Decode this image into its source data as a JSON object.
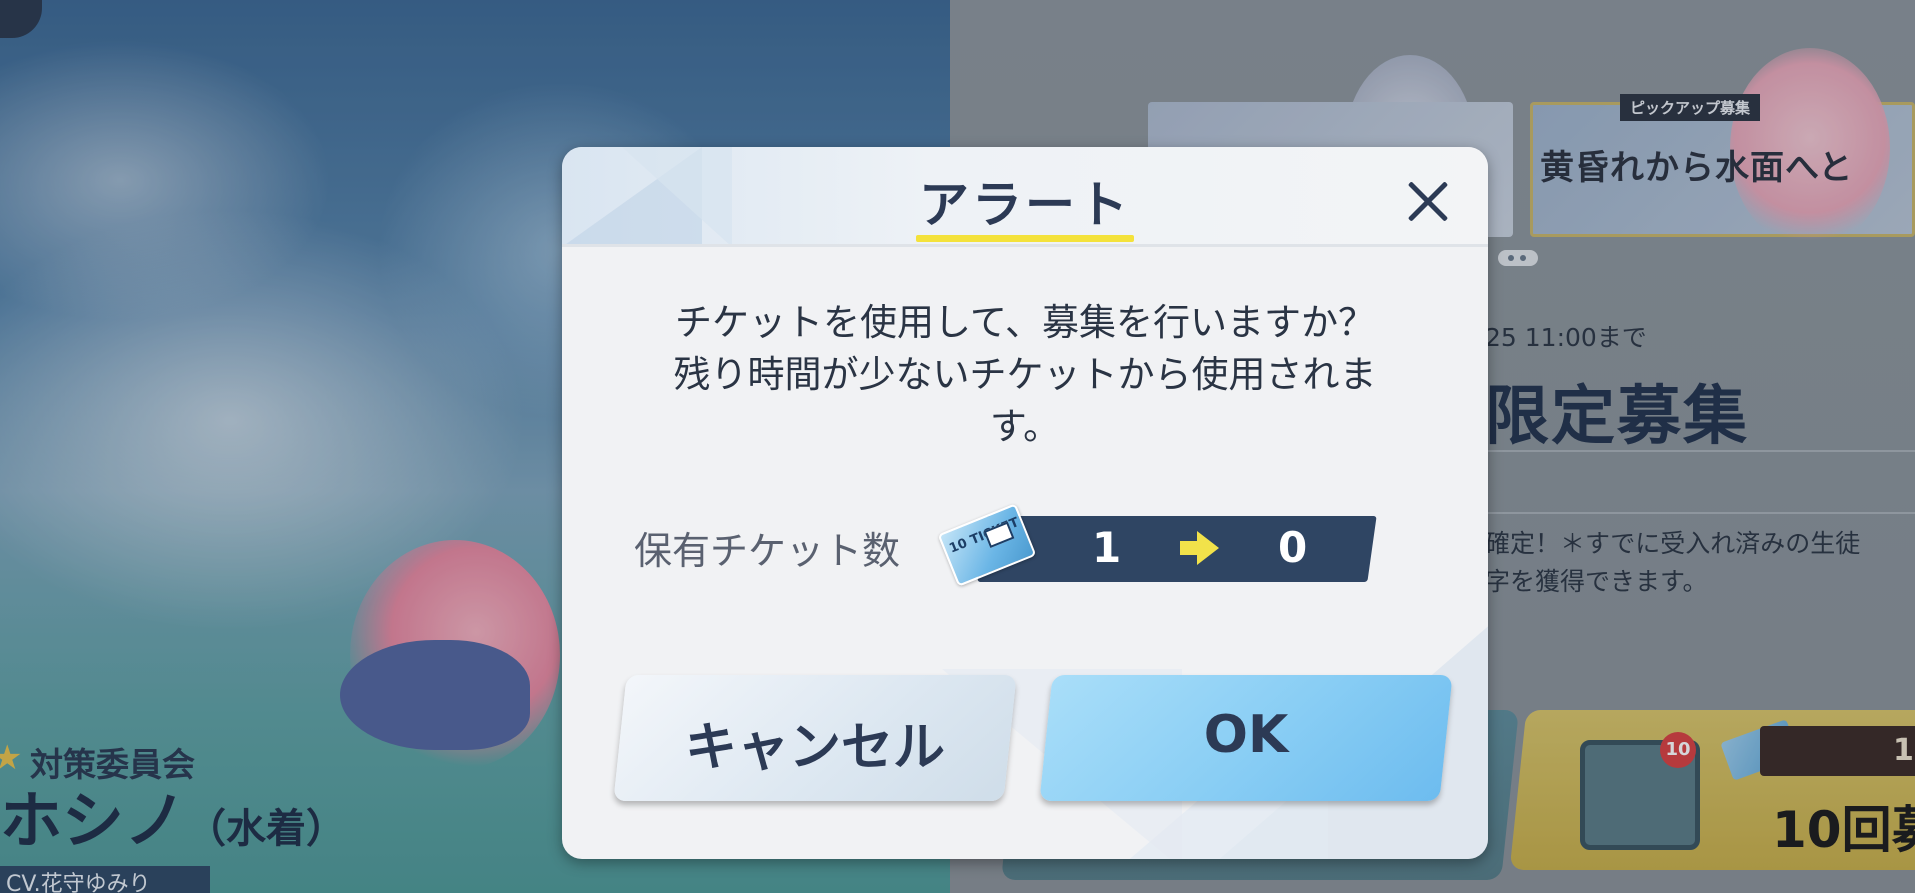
{
  "background": {
    "left": {
      "club": "対策委員会",
      "character_name": "ホシノ",
      "character_variant": "（水着）",
      "cv": "CV.花守ゆみり"
    },
    "right": {
      "banner_tag": "ピックアップ募集",
      "banner_title": "黄昏れから水面へと",
      "date": "25 11:00まで",
      "title": "限定募集",
      "description_line1": "確定！＊すでに受入れ済みの生徒",
      "description_line2": "字を獲得できます。",
      "envelope_badge": "10",
      "ten_count": "1",
      "ten_label": "10回募"
    }
  },
  "modal": {
    "title": "アラート",
    "message_line1": "チケットを使用して、募集を行いますか？",
    "message_line2": "残り時間が少ないチケットから使用されま",
    "message_line3": "す。",
    "ticket_label": "保有チケット数",
    "ticket_icon_text": "10 TICKET",
    "count_from": "1",
    "count_to": "0",
    "cancel_label": "キャンセル",
    "ok_label": "OK"
  },
  "colors": {
    "title_underline": "#f4e23b",
    "arrow": "#f2e24a",
    "count_bar": "#2f4563",
    "ok_button": "#88cdf4",
    "cancel_button": "#dce7f1",
    "text_dark": "#2c3a55"
  },
  "icons": {
    "close": "close-icon",
    "arrow": "arrow-right-icon",
    "ticket": "ticket-icon",
    "star": "star-icon",
    "envelope": "envelope-icon"
  }
}
